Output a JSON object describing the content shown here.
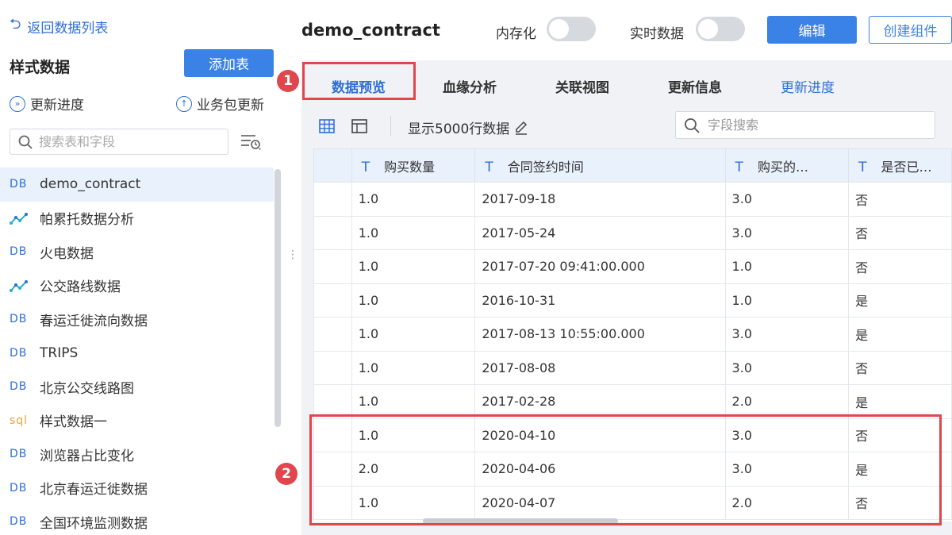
{
  "sidebar": {
    "back_label": "返回数据列表",
    "title": "样式数据",
    "add_button": "添加表",
    "update_progress": "更新进度",
    "package_update": "业务包更新",
    "search_placeholder": "搜索表和字段",
    "items": [
      {
        "tag": "DB",
        "icon": "db-icon",
        "label": "demo_contract",
        "active": true
      },
      {
        "tag": "",
        "icon": "analysis-icon",
        "label": "帕累托数据分析"
      },
      {
        "tag": "DB",
        "icon": "db-icon",
        "label": "火电数据"
      },
      {
        "tag": "",
        "icon": "analysis-icon",
        "label": "公交路线数据"
      },
      {
        "tag": "DB",
        "icon": "db-icon",
        "label": "春运迁徙流向数据"
      },
      {
        "tag": "DB",
        "icon": "db-icon",
        "label": "TRIPS"
      },
      {
        "tag": "DB",
        "icon": "db-icon",
        "label": "北京公交线路图"
      },
      {
        "tag": "sql",
        "icon": "sql-icon",
        "label": "样式数据一"
      },
      {
        "tag": "DB",
        "icon": "db-icon",
        "label": "浏览器占比变化"
      },
      {
        "tag": "DB",
        "icon": "db-icon",
        "label": "北京春运迁徙数据"
      },
      {
        "tag": "DB",
        "icon": "db-icon",
        "label": "全国环境监测数据"
      }
    ]
  },
  "header": {
    "table_name": "demo_contract",
    "in_memory_label": "内存化",
    "realtime_label": "实时数据",
    "edit_button": "编辑",
    "create_button": "创建组件"
  },
  "tabs": [
    {
      "label": "数据预览",
      "active": true
    },
    {
      "label": "血缘分析"
    },
    {
      "label": "关联视图"
    },
    {
      "label": "更新信息"
    },
    {
      "label": "更新进度",
      "link": true
    }
  ],
  "toolbar": {
    "row_count_label": "显示5000行数据",
    "field_search_placeholder": "字段搜索"
  },
  "table": {
    "type_glyph": "T",
    "columns": [
      "购买数量",
      "合同签约时间",
      "购买的…",
      "是否已…"
    ],
    "rows": [
      [
        "1.0",
        "2017-09-18",
        "3.0",
        "否"
      ],
      [
        "1.0",
        "2017-05-24",
        "3.0",
        "否"
      ],
      [
        "1.0",
        "2017-07-20 09:41:00.000",
        "1.0",
        "否"
      ],
      [
        "1.0",
        "2016-10-31",
        "1.0",
        "是"
      ],
      [
        "1.0",
        "2017-08-13 10:55:00.000",
        "3.0",
        "是"
      ],
      [
        "1.0",
        "2017-08-08",
        "3.0",
        "否"
      ],
      [
        "1.0",
        "2017-02-28",
        "2.0",
        "是"
      ],
      [
        "1.0",
        "2020-04-10",
        "3.0",
        "否"
      ],
      [
        "2.0",
        "2020-04-06",
        "3.0",
        "是"
      ],
      [
        "1.0",
        "2020-04-07",
        "2.0",
        "否"
      ]
    ]
  },
  "annotations": {
    "badge_1": "1",
    "badge_2": "2"
  },
  "colors": {
    "accent": "#3b82e6",
    "highlight": "#e0464e",
    "header_bg": "#e9f1fc"
  }
}
